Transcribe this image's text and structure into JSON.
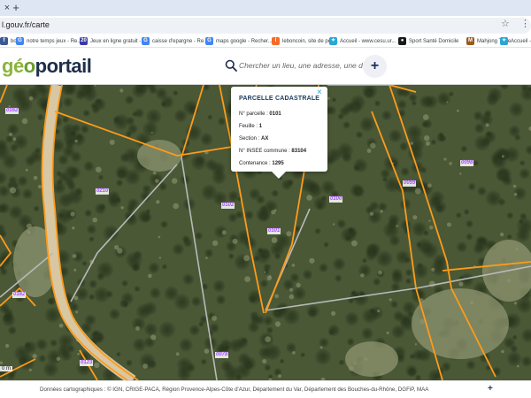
{
  "browser": {
    "tab_close_glyph": "×",
    "new_tab_glyph": "+",
    "url": "l.gouv.fr/carte",
    "bookmarks": [
      {
        "label": "book",
        "icon": "facebook-icon",
        "color": "#3b5998",
        "glyph": "f"
      },
      {
        "label": "notre temps jeux - Re...",
        "icon": "google-icon",
        "color": "#4285f4",
        "glyph": "G"
      },
      {
        "label": "Jeux en ligne gratuit -...",
        "icon": "games-icon",
        "color": "#3a3aa8",
        "glyph": "20"
      },
      {
        "label": "caisse d'epargne - Re...",
        "icon": "google-icon",
        "color": "#4285f4",
        "glyph": "G"
      },
      {
        "label": "maps google - Recher...",
        "icon": "google-icon",
        "color": "#4285f4",
        "glyph": "G"
      },
      {
        "label": "leboncoin, site de peti...",
        "icon": "leboncoin-icon",
        "color": "#f56b2a",
        "glyph": "l"
      },
      {
        "label": "Accueil - www.cesu.ur...",
        "icon": "cesu-icon",
        "color": "#2aa6d6",
        "glyph": "✦"
      },
      {
        "label": "Sport Santé Domicile",
        "icon": "sport-icon",
        "color": "#1a1a1a",
        "glyph": "●"
      },
      {
        "label": "Mahjong Thee",
        "icon": "mahjong-icon",
        "color": "#9a5a1e",
        "glyph": "M"
      },
      {
        "label": "Accueil - A",
        "icon": "cesu-icon",
        "color": "#2aa6d6",
        "glyph": "✦"
      }
    ]
  },
  "site": {
    "logo_prefix": "",
    "logo_g": "g",
    "logo_e": "é",
    "logo_o": "o",
    "logo_rest": "portail",
    "search_placeholder": "Chercher un lieu, une adresse, une donnée",
    "add_glyph": "+"
  },
  "map": {
    "parcels": [
      {
        "id": "p0162a",
        "text": "0162"
      },
      {
        "id": "p0210",
        "text": "0210"
      },
      {
        "id": "p0102",
        "text": "0102"
      },
      {
        "id": "p0101",
        "text": "0101"
      },
      {
        "id": "p0100",
        "text": "0100"
      },
      {
        "id": "p0099",
        "text": "0099"
      },
      {
        "id": "p0098",
        "text": "0098"
      },
      {
        "id": "p0162b",
        "text": "0162"
      },
      {
        "id": "p0123",
        "text": "0123"
      },
      {
        "id": "p0078",
        "text": "0078"
      }
    ],
    "scale": "0 m",
    "colors": {
      "parcel_line": "#ff9b1a",
      "section_line": "#b9b9b9",
      "label": "#a64dff"
    }
  },
  "popup": {
    "title": "PARCELLE CADASTRALE",
    "close_glyph": "×",
    "rows": [
      {
        "label": "N° parcelle : ",
        "value": "0101"
      },
      {
        "label": "Feuille : ",
        "value": "1"
      },
      {
        "label": "Section : ",
        "value": "AX"
      },
      {
        "label": "N° INSEE commune : ",
        "value": "83104"
      },
      {
        "label": "Contenance : ",
        "value": "1295"
      }
    ]
  },
  "footer": {
    "attribution": "Données cartographiques : ©   IGN,  CRIGE-PACA,  Région Provence-Alpes-Côte d'Azur,  Département du Var,  Département des Bouches-du-Rhône,  DGFiP,  MAA",
    "plus_glyph": "+"
  }
}
